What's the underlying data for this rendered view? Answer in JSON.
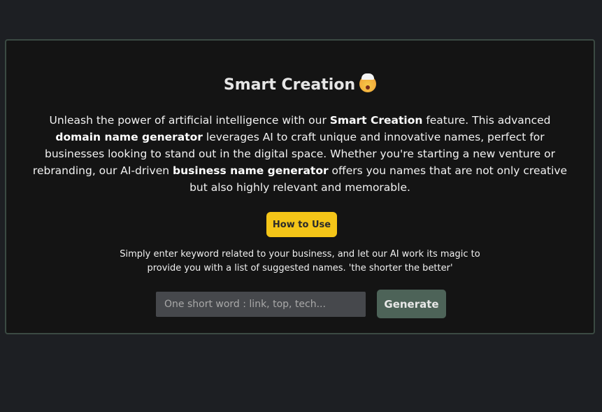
{
  "section": {
    "title": "Smart Creation",
    "title_emoji": "chef-exploding-head-emoji",
    "description": {
      "t1": "Unleash the power of artificial intelligence with our ",
      "b1": "Smart Creation",
      "t2": " feature. This advanced ",
      "b2": "domain name generator",
      "t3": " leverages AI to craft unique and innovative names, perfect for businesses looking to stand out in the digital space. Whether you're starting a new venture or rebranding, our AI-driven ",
      "b3": "business name generator",
      "t4": " offers you names that are not only creative but also highly relevant and memorable."
    },
    "how_to_use_label": "How to Use",
    "hint": "Simply enter keyword related to your business, and let our AI work its magic to provide you with a list of suggested names. 'the shorter the better'",
    "input": {
      "value": "",
      "placeholder": "One short word : link, top, tech..."
    },
    "generate_label": "Generate"
  },
  "colors": {
    "page_background": "#1d1f23",
    "card_background": "#141414",
    "card_border": "#3b4a43",
    "accent_yellow": "#f4c518",
    "generate_button": "#4d6358",
    "input_background": "#46484c"
  }
}
